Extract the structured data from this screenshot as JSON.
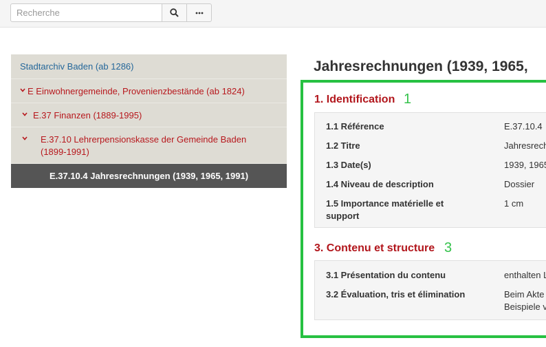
{
  "search": {
    "placeholder": "Recherche"
  },
  "toolbar": {
    "search_icon": "search-icon",
    "more_label": "···"
  },
  "tree": {
    "root": "Stadtarchiv Baden (ab 1286)",
    "level1": "E Einwohnergemeinde, Provenienzbestände (ab 1824)",
    "level2": "E.37 Finanzen (1889-1995)",
    "level3_line1": "E.37.10 Lehrerpensionskasse der Gemeinde Baden",
    "level3_line2": "(1899-1991)",
    "current": "E.37.10.4 Jahresrechnungen (1939, 1965, 1991)",
    "chevron": "›"
  },
  "main": {
    "title": "Jahresrechnungen (1939, 1965,",
    "section1": {
      "title": "1. Identification",
      "badge": "1",
      "fields": [
        {
          "label": "1.1 Référence",
          "value": "E.37.10.4"
        },
        {
          "label": "1.2 Titre",
          "value": "Jahresrech"
        },
        {
          "label": "1.3 Date(s)",
          "value": "1939, 1965"
        },
        {
          "label": "1.4 Niveau de description",
          "value": "Dossier"
        },
        {
          "label_line1": "1.5 Importance matérielle et",
          "label_line2": "support",
          "value": "1 cm"
        }
      ]
    },
    "section3": {
      "title": "3. Contenu et structure",
      "badge": "3",
      "fields": [
        {
          "label": "3.1 Présentation du contenu",
          "value": "enthalten L"
        },
        {
          "label": "3.2 Évaluation, tris et élimination",
          "value_line1": "Beim Akte",
          "value_line2": "Beispiele v"
        }
      ]
    }
  },
  "colors": {
    "accent_red": "#b2161c",
    "link_blue": "#24679a",
    "highlight_green": "#27c142",
    "active_bg": "#555555"
  }
}
